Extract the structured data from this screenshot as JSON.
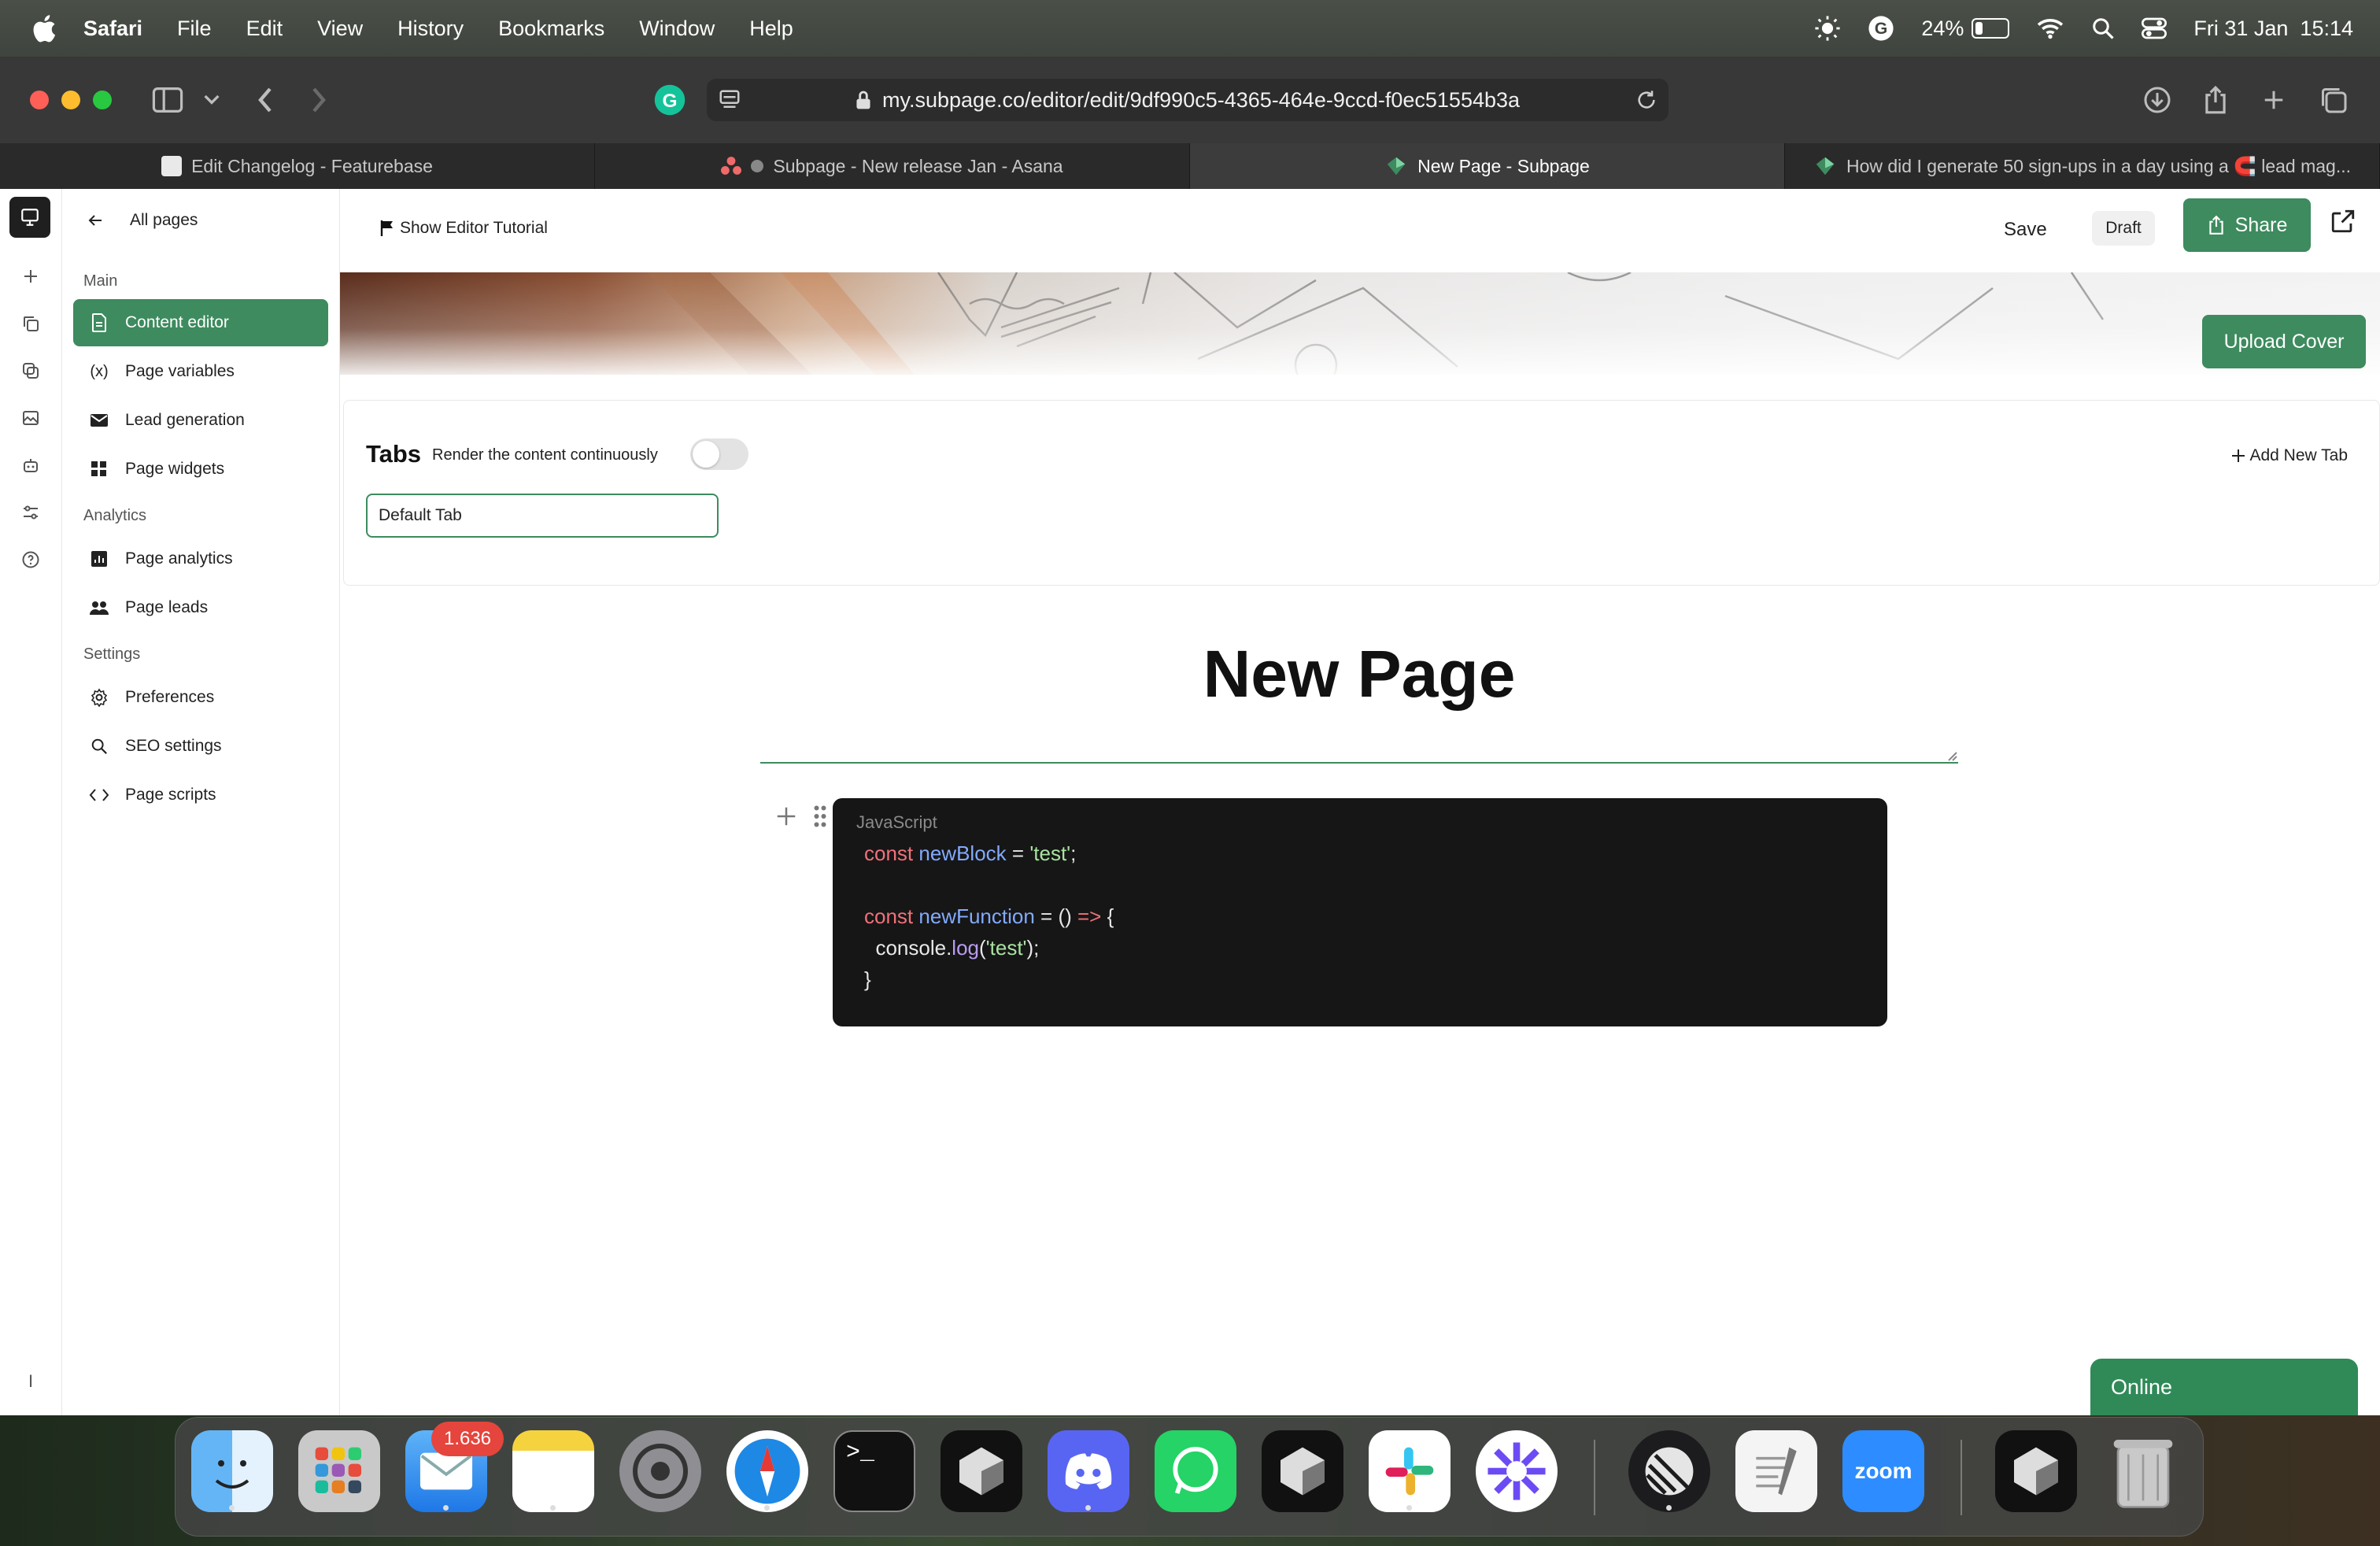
{
  "menubar": {
    "app": "Safari",
    "menus": [
      "File",
      "Edit",
      "View",
      "History",
      "Bookmarks",
      "Window",
      "Help"
    ],
    "battery": "24%",
    "battery_level": 0.24,
    "datetime": "Fri 31 Jan  15:14"
  },
  "browser": {
    "url": "my.subpage.co/editor/edit/9df990c5-4365-464e-9ccd-f0ec51554b3a",
    "tabs": [
      {
        "title": "Edit Changelog - Featurebase",
        "active": false
      },
      {
        "title": "Subpage - New release Jan - Asana",
        "active": false
      },
      {
        "title": "New Page - Subpage",
        "active": true
      },
      {
        "title": "How did I generate 50 sign-ups in a day using a 🧲 lead mag...",
        "active": false
      }
    ]
  },
  "sidebar": {
    "back_label": "All pages",
    "sections": {
      "main": "Main",
      "analytics": "Analytics",
      "settings": "Settings"
    },
    "items": {
      "content_editor": "Content editor",
      "page_variables": "Page variables",
      "lead_generation": "Lead generation",
      "page_widgets": "Page widgets",
      "page_analytics": "Page analytics",
      "page_leads": "Page leads",
      "preferences": "Preferences",
      "seo_settings": "SEO settings",
      "page_scripts": "Page scripts"
    },
    "rail_bottom": "I"
  },
  "topbar": {
    "tutorial": "Show Editor Tutorial",
    "save": "Save",
    "status": "Draft",
    "share": "Share"
  },
  "cover": {
    "upload": "Upload Cover"
  },
  "tabs_panel": {
    "title": "Tabs",
    "render_label": "Render the content continuously",
    "add_tab": "Add New Tab",
    "default_tab": "Default Tab"
  },
  "editor": {
    "page_title": "New Page",
    "code_language": "JavaScript"
  },
  "status": {
    "online": "Online"
  },
  "dock": {
    "mail_badge": "1.636",
    "zoom_label": "zoom"
  },
  "colors": {
    "accent_green": "#3d8b5e",
    "code_bg": "#161616"
  }
}
